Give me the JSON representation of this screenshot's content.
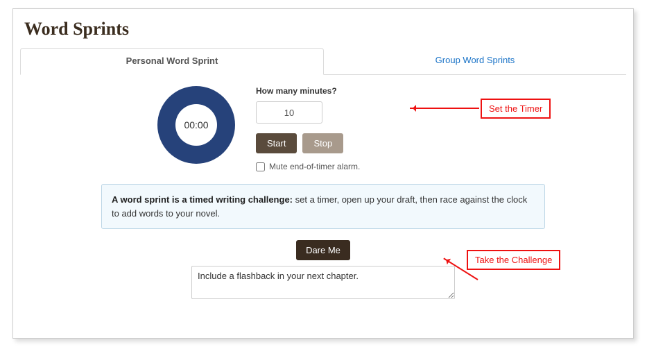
{
  "title": "Word Sprints",
  "tabs": {
    "personal": "Personal Word Sprint",
    "group": "Group Word Sprints"
  },
  "timer": {
    "display": "00:00",
    "minutes_label": "How many minutes?",
    "minutes_value": "10",
    "start_label": "Start",
    "stop_label": "Stop",
    "mute_label": "Mute end-of-timer alarm."
  },
  "info": {
    "bold": "A word sprint is a timed writing challenge:",
    "rest": " set a timer, open up your draft, then race against the clock to add words to your novel."
  },
  "dare": {
    "button_label": "Dare Me",
    "prompt": "Include a flashback in your next chapter."
  },
  "annotations": {
    "set_timer": "Set the Timer",
    "take_challenge": "Take the Challenge"
  },
  "colors": {
    "ring": "#26427a",
    "start_btn": "#5a4b3c",
    "stop_btn": "#a89a8c",
    "dare_btn": "#3a2c20",
    "link": "#1a73c7",
    "callout": "#e11"
  }
}
